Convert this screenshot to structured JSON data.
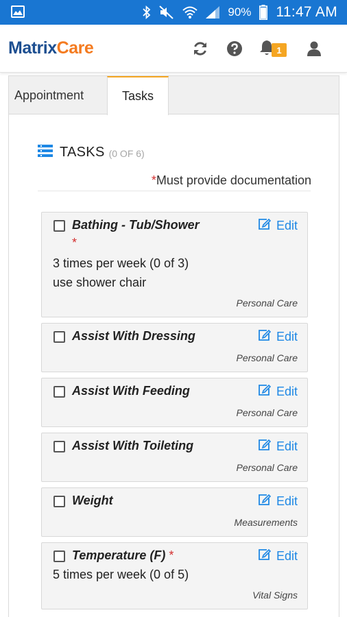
{
  "status_bar": {
    "battery": "90%",
    "time": "11:47 AM"
  },
  "app": {
    "logo_part1": "Matrix",
    "logo_part2": "Care",
    "notification_count": "1",
    "colors": {
      "brand_blue": "#1d4f91",
      "brand_orange": "#f47b20",
      "status_bar": "#1976d2",
      "link": "#1e88e5",
      "required": "#d32f2f",
      "badge": "#f5a623"
    }
  },
  "tabs": [
    {
      "label": "Appointment",
      "active": false
    },
    {
      "label": "Tasks",
      "active": true
    }
  ],
  "tasks_section": {
    "title": "TASKS",
    "count": "(0 OF 6)",
    "required_star": "*",
    "required_note": "Must provide documentation",
    "edit_label": "Edit"
  },
  "tasks": [
    {
      "name": "Bathing - Tub/Shower",
      "required": "*",
      "lines": [
        "3 times per week (0 of 3)",
        "use shower chair"
      ],
      "category": "Personal Care",
      "icon": "checkbox"
    },
    {
      "name": "Assist With Dressing",
      "required": "",
      "lines": [],
      "category": "Personal Care"
    },
    {
      "name": "Assist With Feeding",
      "required": "",
      "lines": [],
      "category": "Personal Care"
    },
    {
      "name": "Assist With Toileting",
      "required": "",
      "lines": [],
      "category": "Personal Care"
    },
    {
      "name": "Weight",
      "required": "",
      "lines": [],
      "category": "Measurements"
    },
    {
      "name": "Temperature (F)",
      "required": "*",
      "lines": [
        "5 times per week (0 of 5)"
      ],
      "category": "Vital Signs"
    }
  ]
}
